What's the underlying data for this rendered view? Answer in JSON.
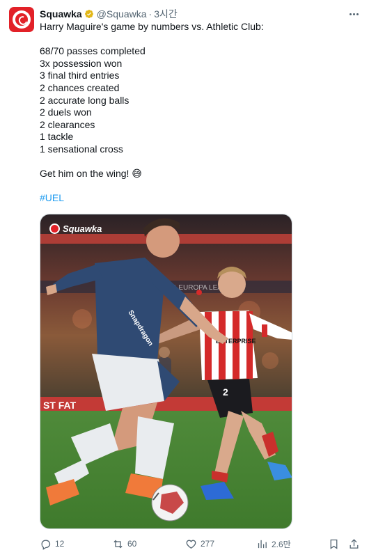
{
  "tweet": {
    "author_name": "Squawka",
    "handle": "@Squawka",
    "separator": "·",
    "time": "3시간",
    "lines": [
      "Harry Maguire's game by numbers vs. Athletic Club:",
      "",
      "68/70 passes completed",
      "3x possession won",
      "3 final third entries",
      "2 chances created",
      "2 accurate long balls",
      "2 duels won",
      "2 clearances",
      "1 tackle",
      "1 sensational cross",
      "",
      "Get him on the wing! 😅",
      ""
    ],
    "hashtag": "#UEL"
  },
  "media": {
    "watermark": "Squawka",
    "board_text": "UEFA EUROPA LEAGUE",
    "ad_text": "ST FAT",
    "jersey_sponsor_left": "Snapdragon",
    "jersey_sponsor_right": "ENTERPRISE",
    "shirt_number": "2"
  },
  "actions": {
    "replies": "12",
    "reposts": "60",
    "likes": "277",
    "views": "2.6만"
  },
  "colors": {
    "brand": "#e22128",
    "link": "#1d9bf0",
    "muted": "#536471",
    "verified": "#e2b719"
  }
}
